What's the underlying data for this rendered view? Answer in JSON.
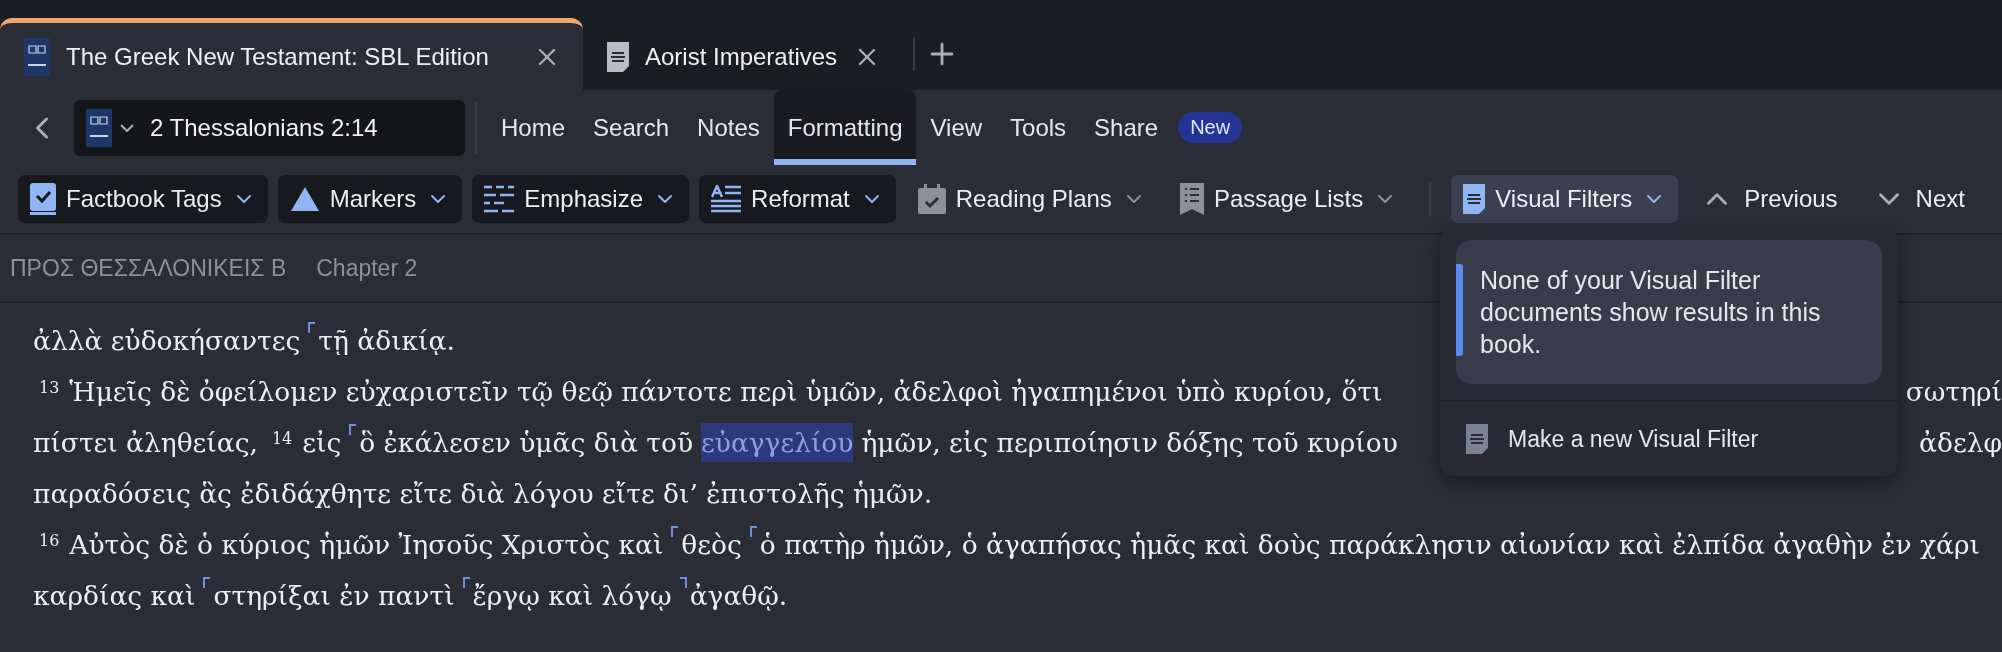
{
  "tabs": [
    {
      "title": "The Greek New Testament: SBL Edition",
      "selected": true,
      "kind": "book"
    },
    {
      "title": "Aorist Imperatives",
      "selected": false,
      "kind": "document"
    }
  ],
  "reference": {
    "text": "2 Thessalonians 2:14"
  },
  "menu": [
    {
      "label": "Home",
      "selected": false
    },
    {
      "label": "Search",
      "selected": false
    },
    {
      "label": "Notes",
      "selected": false
    },
    {
      "label": "Formatting",
      "selected": true
    },
    {
      "label": "View",
      "selected": false
    },
    {
      "label": "Tools",
      "selected": false
    },
    {
      "label": "Share",
      "selected": false
    }
  ],
  "new_badge": "New",
  "toolbar": [
    {
      "label": "Factbook Tags",
      "kind": "filled",
      "open": false
    },
    {
      "label": "Markers",
      "kind": "filled",
      "open": false
    },
    {
      "label": "Emphasize",
      "kind": "filled",
      "open": false
    },
    {
      "label": "Reformat",
      "kind": "filled",
      "open": false
    },
    {
      "label": "Reading Plans",
      "kind": "plain",
      "open": false
    },
    {
      "label": "Passage Lists",
      "kind": "plain",
      "open": false
    },
    {
      "label": "Visual Filters",
      "kind": "plain",
      "open": true
    },
    {
      "label": "Previous",
      "kind": "nav",
      "open": false
    },
    {
      "label": "Next",
      "kind": "nav",
      "open": false
    }
  ],
  "breadcrumb": [
    "ΠΡΟΣ ΘΕΣΣΑΛΟΝΙΚΕΙΣ Β",
    "Chapter 2"
  ],
  "lines": [
    {
      "segments": [
        {
          "kind": "text",
          "text": "ἀλλὰ εὐδοκήσαντες"
        },
        {
          "kind": "open-mark"
        },
        {
          "kind": "text",
          "text": "τῇ ἀδικίᾳ."
        }
      ]
    },
    {
      "segments": [
        {
          "kind": "verse",
          "text": "13"
        },
        {
          "kind": "text",
          "text": "Ἡμεῖς δὲ ὀφείλομεν εὐχαριστεῖν τῷ θεῷ πάντοτε περὶ ὑμῶν, ἀδελφοὶ ἠγαπημένοι ὑπὸ κυρίου, ὅτι"
        },
        {
          "kind": "edge",
          "text": "σωτηρί"
        }
      ]
    },
    {
      "segments": [
        {
          "kind": "text",
          "text": "πίστει ἀληθείας,"
        },
        {
          "kind": "verse",
          "text": "14"
        },
        {
          "kind": "text",
          "text": "εἰς"
        },
        {
          "kind": "open-mark"
        },
        {
          "kind": "text",
          "text": "ὃ ἐκάλεσεν ὑμᾶς διὰ τοῦ"
        },
        {
          "kind": "highlight",
          "text": "εὐαγγελίου"
        },
        {
          "kind": "text",
          "text": "ἡμῶν, εἰς περιποίησιν δόξης τοῦ κυρίου"
        },
        {
          "kind": "edge",
          "text": "ἀδελφ"
        }
      ]
    },
    {
      "segments": [
        {
          "kind": "text",
          "text": "παραδόσεις ἃς ἐδιδάχθητε εἴτε διὰ λόγου εἴτε δι’ ἐπιστολῆς ἡμῶν."
        }
      ]
    },
    {
      "segments": [
        {
          "kind": "verse",
          "text": "16"
        },
        {
          "kind": "text",
          "text": "Αὐτὸς δὲ ὁ κύριος ἡμῶν Ἰησοῦς Χριστὸς καὶ"
        },
        {
          "kind": "open-mark"
        },
        {
          "kind": "text",
          "text": "θεὸς"
        },
        {
          "kind": "open-mark"
        },
        {
          "kind": "text",
          "text": "ὁ πατὴρ ἡμῶν, ὁ ἀγαπήσας ἡμᾶς καὶ δοὺς παράκλησιν αἰωνίαν καὶ ἐλπίδα ἀγαθὴν ἐν χάρι"
        }
      ]
    },
    {
      "segments": [
        {
          "kind": "text",
          "text": "καρδίας καὶ"
        },
        {
          "kind": "open-mark"
        },
        {
          "kind": "text",
          "text": "στηρίξαι ἐν παντὶ"
        },
        {
          "kind": "open-mark"
        },
        {
          "kind": "text",
          "text": "ἔργῳ καὶ λόγῳ"
        },
        {
          "kind": "close-mark"
        },
        {
          "kind": "text",
          "text": "ἀγαθῷ."
        }
      ]
    }
  ],
  "popup": {
    "message": "None of your Visual Filter documents show results in this book.",
    "action": "Make a new Visual Filter"
  }
}
